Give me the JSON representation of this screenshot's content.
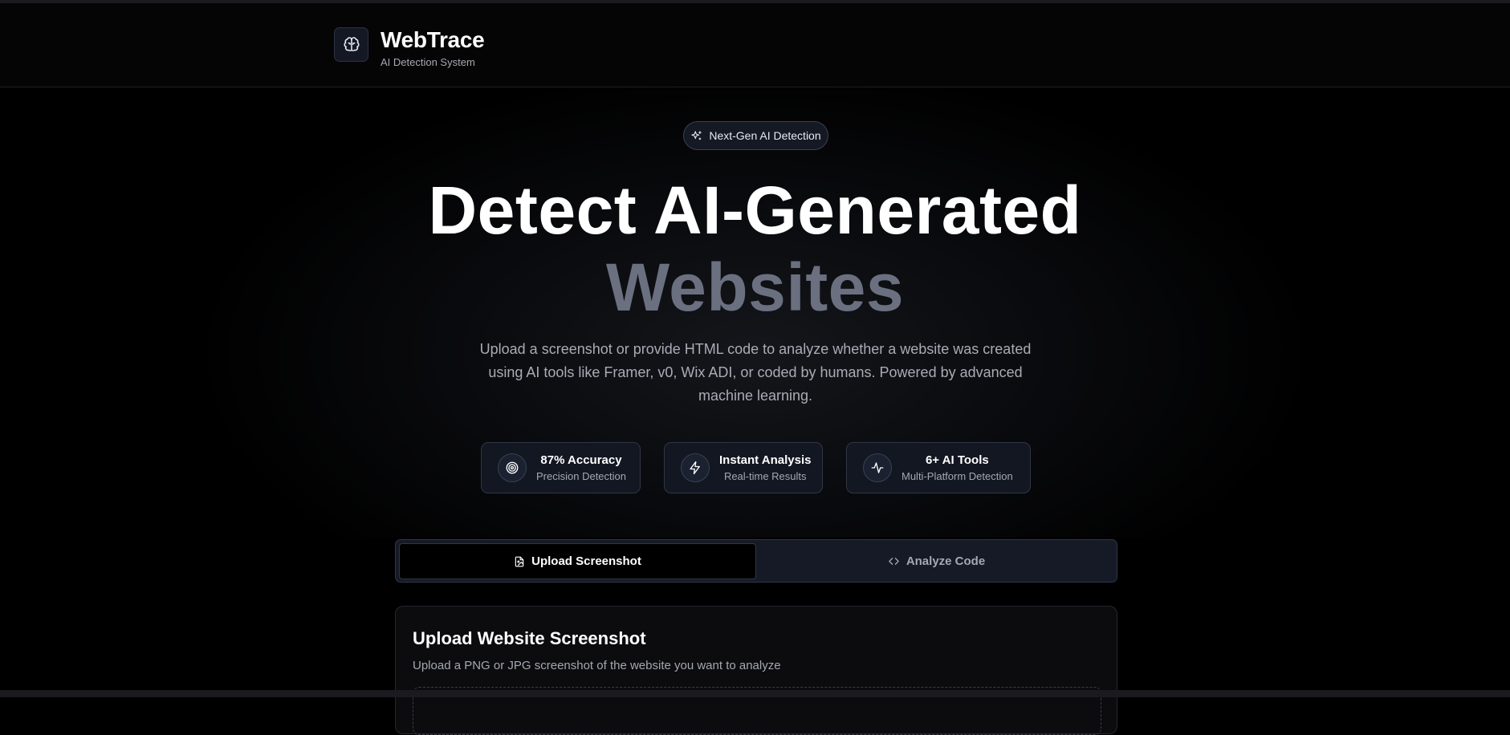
{
  "header": {
    "brand_title": "WebTrace",
    "brand_subtitle": "AI Detection System",
    "logo_icon": "brain-icon"
  },
  "hero": {
    "badge_label": "Next-Gen AI Detection",
    "badge_icon": "sparkles-icon",
    "title_line1": "Detect AI-Generated",
    "title_line2": "Websites",
    "description": "Upload a screenshot or provide HTML code to analyze whether a website was created using AI tools like Framer, v0, Wix ADI, or coded by humans. Powered by advanced machine learning."
  },
  "stats": [
    {
      "icon": "target-icon",
      "title": "87% Accuracy",
      "subtitle": "Precision Detection"
    },
    {
      "icon": "lightning-icon",
      "title": "Instant Analysis",
      "subtitle": "Real-time Results"
    },
    {
      "icon": "activity-icon",
      "title": "6+ AI Tools",
      "subtitle": "Multi-Platform Detection"
    }
  ],
  "tabs": [
    {
      "label": "Upload Screenshot",
      "icon": "file-image-icon",
      "active": true
    },
    {
      "label": "Analyze Code",
      "icon": "code-icon",
      "active": false
    }
  ],
  "upload_card": {
    "title": "Upload Website Screenshot",
    "subtitle": "Upload a PNG or JPG screenshot of the website you want to analyze"
  },
  "colors": {
    "background": "#000000",
    "card_bg": "#121722",
    "border": "#2f3646",
    "muted_text": "#a4a8b3",
    "title_secondary": "#6b7080"
  }
}
